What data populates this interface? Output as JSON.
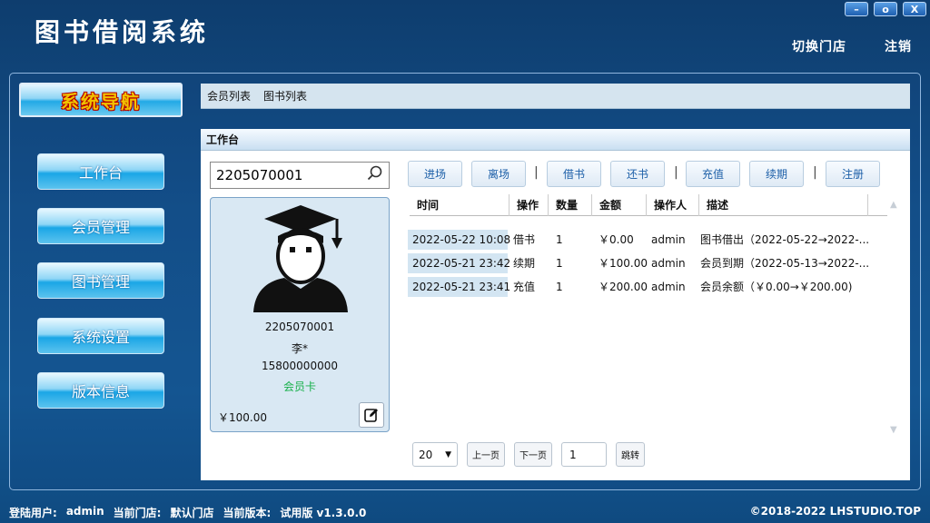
{
  "app_title": "图书借阅系统",
  "window_controls": {
    "minimize": "–",
    "restore": "o",
    "close": "X"
  },
  "top_links": {
    "switch_store": "切换门店",
    "logout": "注销"
  },
  "nav": {
    "title": "系统导航",
    "items": [
      "工作台",
      "会员管理",
      "图书管理",
      "系统设置",
      "版本信息"
    ]
  },
  "tabs": [
    "会员列表",
    "图书列表"
  ],
  "panel": {
    "title": "工作台"
  },
  "search": {
    "value": "2205070001",
    "icon": "search-icon"
  },
  "member": {
    "id": "2205070001",
    "name": "李*",
    "phone": "15800000000",
    "card_type": "会员卡",
    "balance": "￥100.00",
    "card_type_color": "#18b04a"
  },
  "actions": [
    "进场",
    "离场",
    "借书",
    "还书",
    "充值",
    "续期",
    "注册"
  ],
  "table": {
    "headers": [
      "时间",
      "操作",
      "数量",
      "金额",
      "操作人",
      "描述"
    ],
    "rows": [
      [
        "2022-05-22 10:08",
        "借书",
        "1",
        "￥0.00",
        "admin",
        "图书借出（2022-05-22→2022-..."
      ],
      [
        "2022-05-21 23:42",
        "续期",
        "1",
        "￥100.00",
        "admin",
        "会员到期（2022-05-13→2022-..."
      ],
      [
        "2022-05-21 23:41",
        "充值",
        "1",
        "￥200.00",
        "admin",
        "会员余额（￥0.00→￥200.00)"
      ]
    ]
  },
  "pager": {
    "page_size": "20",
    "prev": "上一页",
    "next": "下一页",
    "page": "1",
    "jump": "跳转"
  },
  "status": {
    "user_label": "登陆用户:",
    "user": "admin",
    "store_label": "当前门店:",
    "store": "默认门店",
    "version_label": "当前版本:",
    "version": "试用版 v1.3.0.0",
    "copyright": "©2018-2022 LHSTUDIO.TOP"
  }
}
